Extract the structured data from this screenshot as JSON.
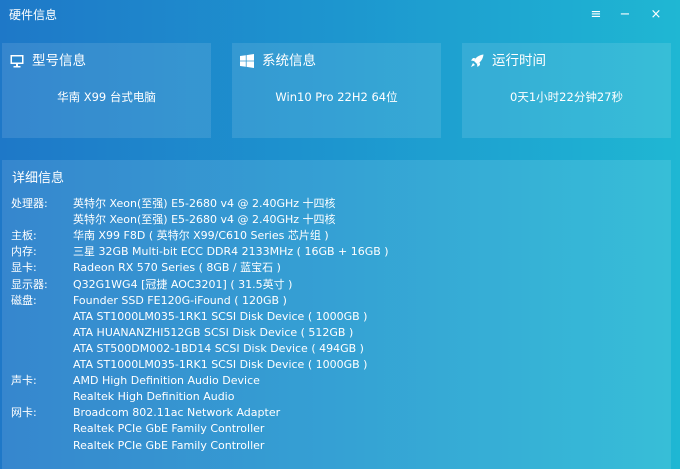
{
  "window": {
    "title": "硬件信息",
    "menu_icon": "≡",
    "minimize_icon": "−",
    "close_icon": "×"
  },
  "cards": {
    "model": {
      "icon": "monitor-icon",
      "title": "型号信息",
      "value": "华南 X99  台式电脑"
    },
    "system": {
      "icon": "windows-logo-icon",
      "title": "系统信息",
      "value": "Win10 Pro 22H2 64位"
    },
    "uptime": {
      "icon": "rocket-icon",
      "title": "运行时间",
      "value": "0天1小时22分钟27秒"
    }
  },
  "details": {
    "title": "详细信息",
    "rows": [
      {
        "label": "处理器:",
        "value": "英特尔 Xeon(至强) E5-2680 v4 @ 2.40GHz 十四核"
      },
      {
        "label": "",
        "value": "英特尔 Xeon(至强) E5-2680 v4 @ 2.40GHz 十四核"
      },
      {
        "label": "主板:",
        "value": "华南 X99 F8D ( 英特尔 X99/C610 Series 芯片组 )"
      },
      {
        "label": "内存:",
        "value": "三星 32GB Multi-bit ECC DDR4 2133MHz ( 16GB + 16GB )"
      },
      {
        "label": "显卡:",
        "value": "Radeon RX 570 Series ( 8GB / 蓝宝石 )"
      },
      {
        "label": "显示器:",
        "value": "Q32G1WG4 [冠捷 AOC3201] ( 31.5英寸 )"
      },
      {
        "label": "磁盘:",
        "value": "Founder SSD FE120G-iFound ( 120GB )"
      },
      {
        "label": "",
        "value": "ATA ST1000LM035-1RK1 SCSI Disk Device ( 1000GB )"
      },
      {
        "label": "",
        "value": "ATA HUANANZHI512GB SCSI Disk Device ( 512GB )"
      },
      {
        "label": "",
        "value": "ATA ST500DM002-1BD14 SCSI Disk Device ( 494GB )"
      },
      {
        "label": "",
        "value": "ATA ST1000LM035-1RK1 SCSI Disk Device ( 1000GB )"
      },
      {
        "label": "声卡:",
        "value": "AMD High Definition Audio Device"
      },
      {
        "label": "",
        "value": "Realtek High Definition Audio"
      },
      {
        "label": "网卡:",
        "value": "Broadcom 802.11ac Network Adapter"
      },
      {
        "label": "",
        "value": "Realtek PCIe GbE Family Controller"
      },
      {
        "label": "",
        "value": "Realtek PCIe GbE Family Controller"
      }
    ]
  }
}
